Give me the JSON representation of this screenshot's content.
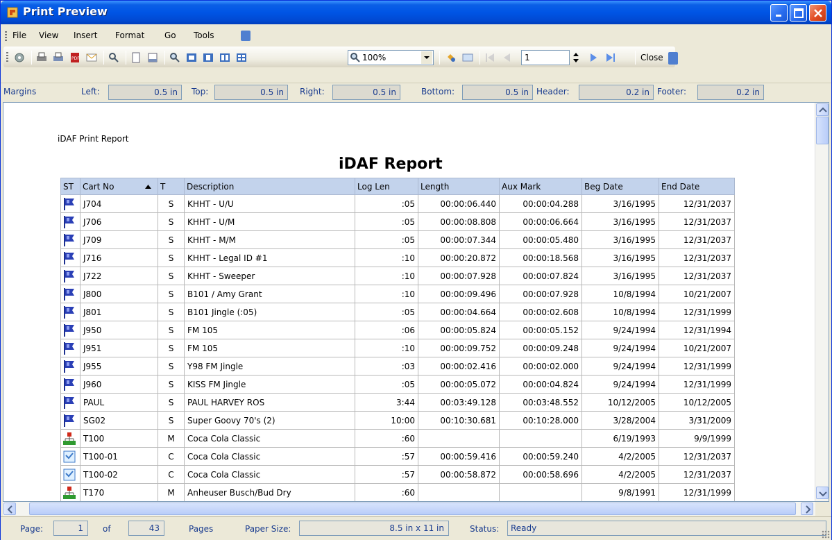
{
  "window": {
    "title": "Print Preview"
  },
  "menu": {
    "items": [
      "File",
      "View",
      "Insert",
      "Format",
      "Go",
      "Tools"
    ]
  },
  "toolbar": {
    "zoom": "100%",
    "page": "1",
    "close_label": "Close"
  },
  "margins": {
    "label": "Margins",
    "fields": [
      {
        "label": "Left:",
        "value": "0.5 in"
      },
      {
        "label": "Top:",
        "value": "0.5 in"
      },
      {
        "label": "Right:",
        "value": "0.5 in"
      },
      {
        "label": "Bottom:",
        "value": "0.5 in"
      },
      {
        "label": "Header:",
        "value": "0.2 in"
      },
      {
        "label": "Footer:",
        "value": "0.2 in"
      }
    ]
  },
  "report": {
    "caption": "iDAF Print Report",
    "title": "iDAF Report",
    "columns": [
      "ST",
      "Cart No",
      "T",
      "Description",
      "Log Len",
      "Length",
      "Aux Mark",
      "Beg Date",
      "End Date"
    ],
    "rows": [
      {
        "icon": "flag-icon",
        "cart": "J704",
        "t": "S",
        "desc": "KHHT - U/U",
        "loglen": ":05",
        "length": "00:00:06.440",
        "aux": "00:00:04.288",
        "beg": "3/16/1995",
        "end": "12/31/2037"
      },
      {
        "icon": "flag-icon",
        "cart": "J706",
        "t": "S",
        "desc": "KHHT - U/M",
        "loglen": ":05",
        "length": "00:00:08.808",
        "aux": "00:00:06.664",
        "beg": "3/16/1995",
        "end": "12/31/2037"
      },
      {
        "icon": "flag-icon",
        "cart": "J709",
        "t": "S",
        "desc": "KHHT - M/M",
        "loglen": ":05",
        "length": "00:00:07.344",
        "aux": "00:00:05.480",
        "beg": "3/16/1995",
        "end": "12/31/2037"
      },
      {
        "icon": "flag-icon",
        "cart": "J716",
        "t": "S",
        "desc": "KHHT - Legal ID #1",
        "loglen": ":10",
        "length": "00:00:20.872",
        "aux": "00:00:18.568",
        "beg": "3/16/1995",
        "end": "12/31/2037"
      },
      {
        "icon": "flag-icon",
        "cart": "J722",
        "t": "S",
        "desc": "KHHT - Sweeper",
        "loglen": ":10",
        "length": "00:00:07.928",
        "aux": "00:00:07.824",
        "beg": "3/16/1995",
        "end": "12/31/2037"
      },
      {
        "icon": "flag-icon",
        "cart": "J800",
        "t": "S",
        "desc": "B101 / Amy Grant",
        "loglen": ":10",
        "length": "00:00:09.496",
        "aux": "00:00:07.928",
        "beg": "10/8/1994",
        "end": "10/21/2007"
      },
      {
        "icon": "flag-icon",
        "cart": "J801",
        "t": "S",
        "desc": "B101 Jingle (:05)",
        "loglen": ":05",
        "length": "00:00:04.664",
        "aux": "00:00:02.608",
        "beg": "10/8/1994",
        "end": "12/31/1999"
      },
      {
        "icon": "flag-icon",
        "cart": "J950",
        "t": "S",
        "desc": "FM 105",
        "loglen": ":06",
        "length": "00:00:05.824",
        "aux": "00:00:05.152",
        "beg": "9/24/1994",
        "end": "12/31/1994"
      },
      {
        "icon": "flag-icon",
        "cart": "J951",
        "t": "S",
        "desc": "FM 105",
        "loglen": ":10",
        "length": "00:00:09.752",
        "aux": "00:00:09.248",
        "beg": "9/24/1994",
        "end": "10/21/2007"
      },
      {
        "icon": "flag-icon",
        "cart": "J955",
        "t": "S",
        "desc": "Y98 FM Jingle",
        "loglen": ":03",
        "length": "00:00:02.416",
        "aux": "00:00:02.000",
        "beg": "9/24/1994",
        "end": "12/31/1999"
      },
      {
        "icon": "flag-icon",
        "cart": "J960",
        "t": "S",
        "desc": "KISS FM Jingle",
        "loglen": ":05",
        "length": "00:00:05.072",
        "aux": "00:00:04.824",
        "beg": "9/24/1994",
        "end": "12/31/1999"
      },
      {
        "icon": "flag-icon",
        "cart": "PAUL",
        "t": "S",
        "desc": "PAUL HARVEY ROS",
        "loglen": "3:44",
        "length": "00:03:49.128",
        "aux": "00:03:48.552",
        "beg": "10/12/2005",
        "end": "10/12/2005"
      },
      {
        "icon": "flag-icon",
        "cart": "SG02",
        "t": "S",
        "desc": "Super Goovy 70's (2)",
        "loglen": "10:00",
        "length": "00:10:30.681",
        "aux": "00:10:28.000",
        "beg": "3/28/2004",
        "end": "3/31/2009"
      },
      {
        "icon": "hierarchy-icon",
        "cart": "T100",
        "t": "M",
        "desc": "Coca Cola Classic",
        "loglen": ":60",
        "length": "",
        "aux": "",
        "beg": "6/19/1993",
        "end": "9/9/1999"
      },
      {
        "icon": "document-icon",
        "cart": "T100-01",
        "t": "C",
        "desc": "Coca Cola Classic",
        "loglen": ":57",
        "length": "00:00:59.416",
        "aux": "00:00:59.240",
        "beg": "4/2/2005",
        "end": "12/31/2037"
      },
      {
        "icon": "document-icon",
        "cart": "T100-02",
        "t": "C",
        "desc": "Coca Cola Classic",
        "loglen": ":57",
        "length": "00:00:58.872",
        "aux": "00:00:58.696",
        "beg": "4/2/2005",
        "end": "12/31/2037"
      },
      {
        "icon": "hierarchy-icon",
        "cart": "T170",
        "t": "M",
        "desc": "Anheuser Busch/Bud Dry",
        "loglen": ":60",
        "length": "",
        "aux": "",
        "beg": "9/8/1991",
        "end": "12/31/1999"
      }
    ]
  },
  "status": {
    "page_label": "Page:",
    "page": "1",
    "of_label": "of",
    "total": "43",
    "pages_label": "Pages",
    "paper_label": "Paper Size:",
    "paper": "8.5 in x 11 in",
    "status_label": "Status:",
    "status": "Ready"
  }
}
